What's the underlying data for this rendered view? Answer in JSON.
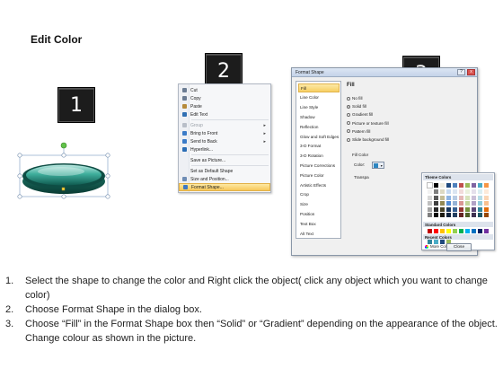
{
  "page": {
    "title": "Edit Color"
  },
  "steps": [
    {
      "number": "1"
    },
    {
      "number": "2"
    },
    {
      "number": "3"
    }
  ],
  "context_menu": {
    "items": [
      {
        "label": "Cut",
        "icon": "scissors-icon",
        "icon_color": "#6b7c93",
        "disabled": false,
        "submenu": false
      },
      {
        "label": "Copy",
        "icon": "copy-icon",
        "icon_color": "#6b7c93",
        "disabled": false,
        "submenu": false
      },
      {
        "label": "Paste",
        "icon": "paste-icon",
        "icon_color": "#b58a3a",
        "disabled": false,
        "submenu": false
      },
      {
        "label": "Edit Text",
        "icon": "edit-text-icon",
        "icon_color": "#2f6fb3",
        "disabled": false,
        "submenu": false
      },
      {
        "label": "Group",
        "icon": "group-icon",
        "icon_color": "#b8bec8",
        "disabled": true,
        "submenu": true
      },
      {
        "label": "Bring to Front",
        "icon": "bring-front-icon",
        "icon_color": "#3a7bc8",
        "disabled": false,
        "submenu": true
      },
      {
        "label": "Send to Back",
        "icon": "send-back-icon",
        "icon_color": "#3a7bc8",
        "disabled": false,
        "submenu": true
      },
      {
        "label": "Hyperlink...",
        "icon": "hyperlink-icon",
        "icon_color": "#2a6db5",
        "disabled": false,
        "submenu": false
      },
      {
        "label": "Save as Picture...",
        "icon": "",
        "icon_color": "",
        "disabled": false,
        "submenu": false
      },
      {
        "label": "Set as Default Shape",
        "icon": "",
        "icon_color": "",
        "disabled": false,
        "submenu": false
      },
      {
        "label": "Size and Position...",
        "icon": "size-position-icon",
        "icon_color": "#6e8db5",
        "disabled": false,
        "submenu": false
      },
      {
        "label": "Format Shape...",
        "icon": "format-shape-icon",
        "icon_color": "#3e78c2",
        "disabled": false,
        "submenu": false,
        "highlighted": true
      }
    ]
  },
  "dialog": {
    "title": "Format Shape",
    "title_buttons": {
      "help": "?",
      "close": "x"
    },
    "categories": [
      "Fill",
      "Line Color",
      "Line Style",
      "Shadow",
      "Reflection",
      "Glow and Soft Edges",
      "3-D Format",
      "3-D Rotation",
      "Picture Corrections",
      "Picture Color",
      "Artistic Effects",
      "Crop",
      "Size",
      "Position",
      "Text Box",
      "Alt Text"
    ],
    "selected_category": "Fill",
    "fill_heading": "Fill",
    "fill_options": [
      {
        "label": "No fill",
        "selected": false
      },
      {
        "label": "Solid fill",
        "selected": true
      },
      {
        "label": "Gradient fill",
        "selected": false
      },
      {
        "label": "Picture or texture fill",
        "selected": false
      },
      {
        "label": "Pattern fill",
        "selected": false
      },
      {
        "label": "Slide background fill",
        "selected": false
      }
    ],
    "fill_color_label": "Fill Color",
    "color_label": "Color:",
    "transparency_label": "Transpa",
    "palette": {
      "theme_colors_label": "Theme Colors",
      "standard_colors_label": "Standard Colors",
      "recent_colors_label": "Recent Colors",
      "more_colors_label": "More Colors...",
      "theme_top_row": [
        "#ffffff",
        "#000000",
        "#eeece1",
        "#1f497d",
        "#4f81bd",
        "#c0504d",
        "#9bbb59",
        "#8064a2",
        "#4bacc6",
        "#f79646"
      ],
      "theme_columns": [
        [
          "#f2f2f2",
          "#d8d8d8",
          "#bfbfbf",
          "#a5a5a5",
          "#7f7f7f"
        ],
        [
          "#7f7f7f",
          "#595959",
          "#3f3f3f",
          "#262626",
          "#0c0c0c"
        ],
        [
          "#ddd9c3",
          "#c4bd97",
          "#938953",
          "#494429",
          "#1d1b10"
        ],
        [
          "#c6d9f0",
          "#8db3e2",
          "#548dd4",
          "#17365d",
          "#0f243e"
        ],
        [
          "#dbe5f1",
          "#b8cce4",
          "#95b3d7",
          "#366092",
          "#244061"
        ],
        [
          "#f2dcdb",
          "#e5b9b7",
          "#d99694",
          "#953734",
          "#632423"
        ],
        [
          "#ebf1dd",
          "#d7e3bc",
          "#c3d69b",
          "#76923c",
          "#4f6128"
        ],
        [
          "#e5e0ec",
          "#ccc1d9",
          "#b2a2c7",
          "#5f497a",
          "#3f3151"
        ],
        [
          "#dbeef3",
          "#b7dde8",
          "#92cddc",
          "#31859b",
          "#205867"
        ],
        [
          "#fdeada",
          "#fbd5b5",
          "#fac08f",
          "#e36c09",
          "#974806"
        ]
      ],
      "standard_colors": [
        "#c00000",
        "#ff0000",
        "#ffc000",
        "#ffff00",
        "#92d050",
        "#00b050",
        "#00b0f0",
        "#0070c0",
        "#002060",
        "#7030a0"
      ],
      "recent_colors": [
        "#31859b",
        "#4bacc6",
        "#1f497d",
        "#9bbb59"
      ]
    },
    "close_label": "Close"
  },
  "instructions": [
    {
      "num": "1.",
      "text": "Select the shape to change the color and Right click the object( click any object which you want to change color)"
    },
    {
      "num": "2.",
      "text": "Choose Format Shape in the dialog box."
    },
    {
      "num": "3.",
      "text": "Choose “Fill” in the Format Shape box then “Solid” or “Gradient” depending on the appearance of the object. Change colour as shown in the picture."
    }
  ]
}
